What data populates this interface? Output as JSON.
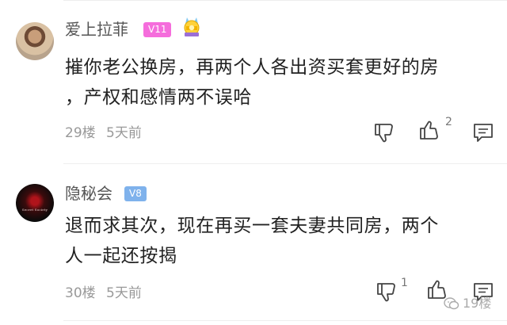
{
  "comments": [
    {
      "username": "爱上拉菲",
      "vip": "V11",
      "text_lines": [
        "摧你老公换房，再两个人各出资买套更好的房",
        "，产权和感情两不误哈"
      ],
      "floor": "29楼",
      "time": "5天前",
      "dislike_count": "",
      "like_count": "2"
    },
    {
      "username": "隐秘会",
      "vip": "V8",
      "avatar_text": "Secret Society",
      "text_lines": [
        "退而求其次，现在再买一套夫妻共同房，两个",
        "人一起还按揭"
      ],
      "floor": "30楼",
      "time": "5天前",
      "dislike_count": "1",
      "like_count": ""
    }
  ],
  "watermark": "19楼",
  "colors": {
    "vip11": "#f56ddc",
    "vip8": "#7fb2ec",
    "meta": "#999999"
  },
  "icons": [
    "thumb-down-icon",
    "thumb-up-icon",
    "comment-icon",
    "medal-icon",
    "wechat-icon"
  ]
}
